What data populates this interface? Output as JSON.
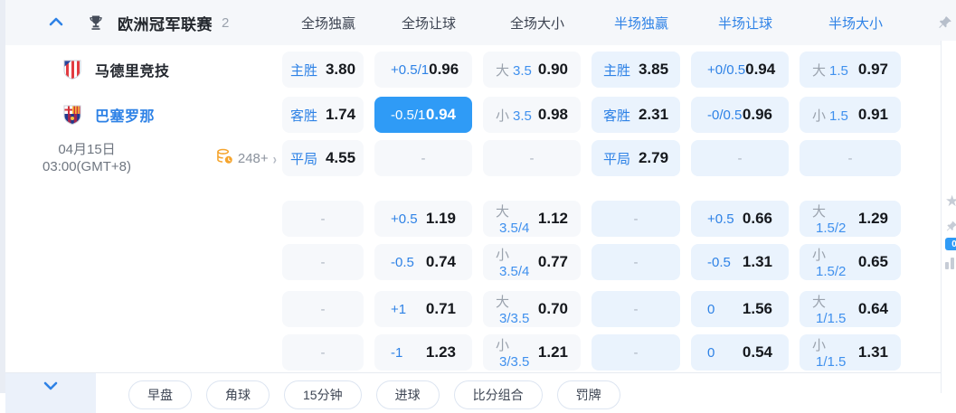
{
  "league": {
    "title": "欧洲冠军联赛",
    "count": "2",
    "collapse_icon": "chevron-up",
    "trophy_icon": "trophy",
    "pin_icon": "pushpin"
  },
  "columns": [
    {
      "label": "全场独赢",
      "period": "full"
    },
    {
      "label": "全场让球",
      "period": "full"
    },
    {
      "label": "全场大小",
      "period": "full"
    },
    {
      "label": "半场独赢",
      "period": "half"
    },
    {
      "label": "半场让球",
      "period": "half"
    },
    {
      "label": "半场大小",
      "period": "half"
    }
  ],
  "match": {
    "home_name": "马德里竞技",
    "away_name": "巴塞罗那",
    "date_line1": "04月15日",
    "date_line2": "03:00(GMT+8)",
    "markets_count": "248+",
    "markets_icon": "coin-clock",
    "more_icon": "chevron-right"
  },
  "odds_rows": [
    {
      "cells": [
        {
          "t": "bet",
          "label": "主胜",
          "value": "3.80"
        },
        {
          "t": "hcp",
          "label": "+0.5/1",
          "value": "0.96"
        },
        {
          "t": "ou",
          "side": "大",
          "line": "3.5",
          "value": "0.90"
        },
        {
          "t": "bet",
          "label": "主胜",
          "value": "3.85"
        },
        {
          "t": "hcp",
          "label": "+0/0.5",
          "value": "0.94"
        },
        {
          "t": "ou",
          "side": "大",
          "line": "1.5",
          "value": "0.97"
        }
      ]
    },
    {
      "cells": [
        {
          "t": "bet",
          "label": "客胜",
          "value": "1.74"
        },
        {
          "t": "hcp",
          "label": "-0.5/1",
          "value": "0.94",
          "sel": true
        },
        {
          "t": "ou",
          "side": "小",
          "line": "3.5",
          "value": "0.98"
        },
        {
          "t": "bet",
          "label": "客胜",
          "value": "2.31"
        },
        {
          "t": "hcp",
          "label": "-0/0.5",
          "value": "0.96"
        },
        {
          "t": "ou",
          "side": "小",
          "line": "1.5",
          "value": "0.91"
        }
      ]
    },
    {
      "cells": [
        {
          "t": "bet",
          "label": "平局",
          "value": "4.55"
        },
        {
          "t": "dash"
        },
        {
          "t": "dash"
        },
        {
          "t": "bet",
          "label": "平局",
          "value": "2.79"
        },
        {
          "t": "dash"
        },
        {
          "t": "dash"
        }
      ]
    },
    {
      "cells": [
        {
          "t": "dash"
        },
        {
          "t": "hcp",
          "label": "+0.5",
          "value": "1.19"
        },
        {
          "t": "ou",
          "side": "大",
          "line": "3.5/4",
          "value": "1.12"
        },
        {
          "t": "dash"
        },
        {
          "t": "hcp",
          "label": "+0.5",
          "value": "0.66"
        },
        {
          "t": "ou",
          "side": "大",
          "line": "1.5/2",
          "value": "1.29"
        }
      ]
    },
    {
      "cells": [
        {
          "t": "dash"
        },
        {
          "t": "hcp",
          "label": "-0.5",
          "value": "0.74"
        },
        {
          "t": "ou",
          "side": "小",
          "line": "3.5/4",
          "value": "0.77"
        },
        {
          "t": "dash"
        },
        {
          "t": "hcp",
          "label": "-0.5",
          "value": "1.31"
        },
        {
          "t": "ou",
          "side": "小",
          "line": "1.5/2",
          "value": "0.65"
        }
      ]
    },
    {
      "cells": [
        {
          "t": "dash"
        },
        {
          "t": "hcp",
          "label": "+1",
          "value": "0.71"
        },
        {
          "t": "ou",
          "side": "大",
          "line": "3/3.5",
          "value": "0.70"
        },
        {
          "t": "dash"
        },
        {
          "t": "hcp",
          "label": "0",
          "value": "1.56"
        },
        {
          "t": "ou",
          "side": "大",
          "line": "1/1.5",
          "value": "0.64"
        }
      ]
    },
    {
      "cells": [
        {
          "t": "dash"
        },
        {
          "t": "hcp",
          "label": "-1",
          "value": "1.23"
        },
        {
          "t": "ou",
          "side": "小",
          "line": "3/3.5",
          "value": "1.21"
        },
        {
          "t": "dash"
        },
        {
          "t": "hcp",
          "label": "0",
          "value": "0.54"
        },
        {
          "t": "ou",
          "side": "小",
          "line": "1/1.5",
          "value": "1.31"
        }
      ]
    }
  ],
  "footer": {
    "collapse_icon": "chevron-down",
    "pills": [
      "早盘",
      "角球",
      "15分钟",
      "进球",
      "比分组合",
      "罚牌"
    ]
  },
  "side_rail": {
    "icons": [
      "star",
      "pin",
      "zero-badge",
      "stats"
    ],
    "badge_label": "0"
  },
  "colors": {
    "accent_blue": "#2e82e6",
    "selected_cell": "#2f9bf6",
    "fulltime_cell_bg": "#f6f8fb",
    "halftime_cell_bg": "#eaf3fd",
    "header_bg": "#f5f7fa",
    "orange_icon": "#f5a42c"
  }
}
